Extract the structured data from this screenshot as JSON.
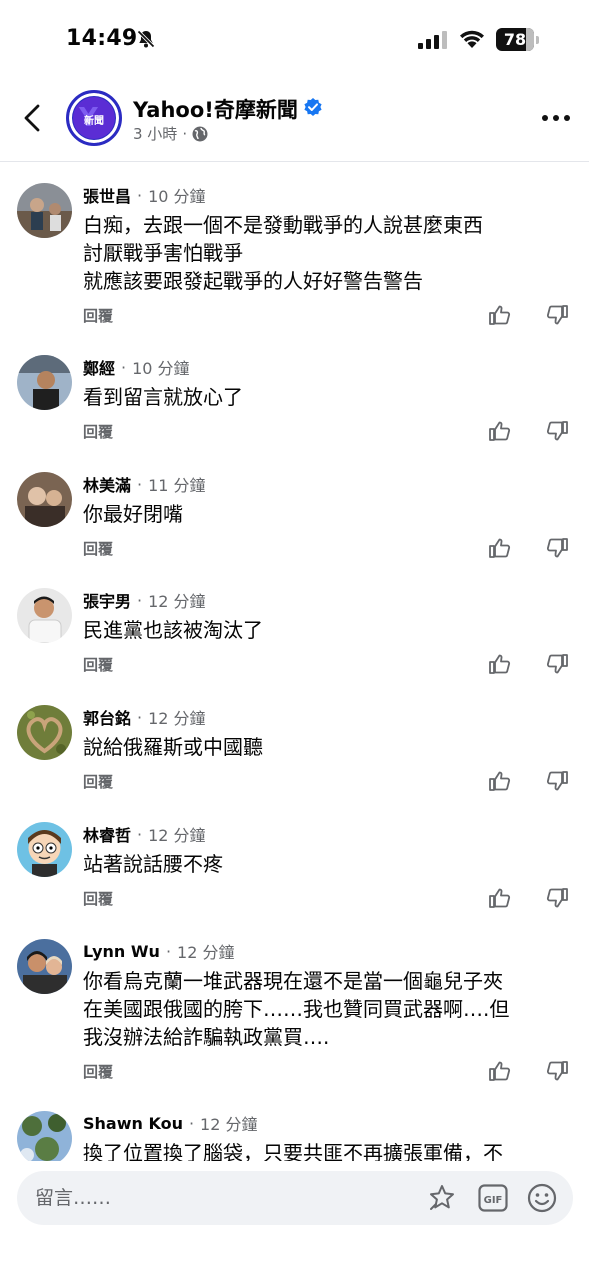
{
  "status_bar": {
    "time": "14:49",
    "battery": "78",
    "battery_level": 0.78
  },
  "header": {
    "page_name": "Yahoo!奇摩新聞",
    "avatar_label": "新聞",
    "post_time": "3 小時",
    "separator": "·"
  },
  "comments": [
    {
      "name": "張世昌",
      "time": "10 分鐘",
      "text": "白痴，去跟一個不是發動戰爭的人說甚麼東西\n討厭戰爭害怕戰爭\n就應該要跟發起戰爭的人好好警告警告",
      "reply": "回覆"
    },
    {
      "name": "鄭經",
      "time": "10 分鐘",
      "text": "看到留言就放心了",
      "reply": "回覆"
    },
    {
      "name": "林美滿",
      "time": "11 分鐘",
      "text": "你最好閉嘴",
      "reply": "回覆"
    },
    {
      "name": "張宇男",
      "time": "12 分鐘",
      "text": "民進黨也該被淘汰了",
      "reply": "回覆"
    },
    {
      "name": "郭台銘",
      "time": "12 分鐘",
      "text": "說給俄羅斯或中國聽",
      "reply": "回覆"
    },
    {
      "name": "林睿哲",
      "time": "12 分鐘",
      "text": "站著說話腰不疼",
      "reply": "回覆"
    },
    {
      "name": "Lynn Wu",
      "time": "12 分鐘",
      "text": "你看烏克蘭一堆武器現在還不是當一個龜兒子夾\n在美國跟俄國的胯下……我也贊同買武器啊….但\n我沒辦法給詐騙執政黨買….",
      "reply": "回覆"
    },
    {
      "name": "Shawn Kou",
      "time": "12 分鐘",
      "text": "換了位置換了腦袋，只要共匪不再擴張軍備，不",
      "reply": ""
    }
  ],
  "composer": {
    "placeholder": "留言……"
  }
}
